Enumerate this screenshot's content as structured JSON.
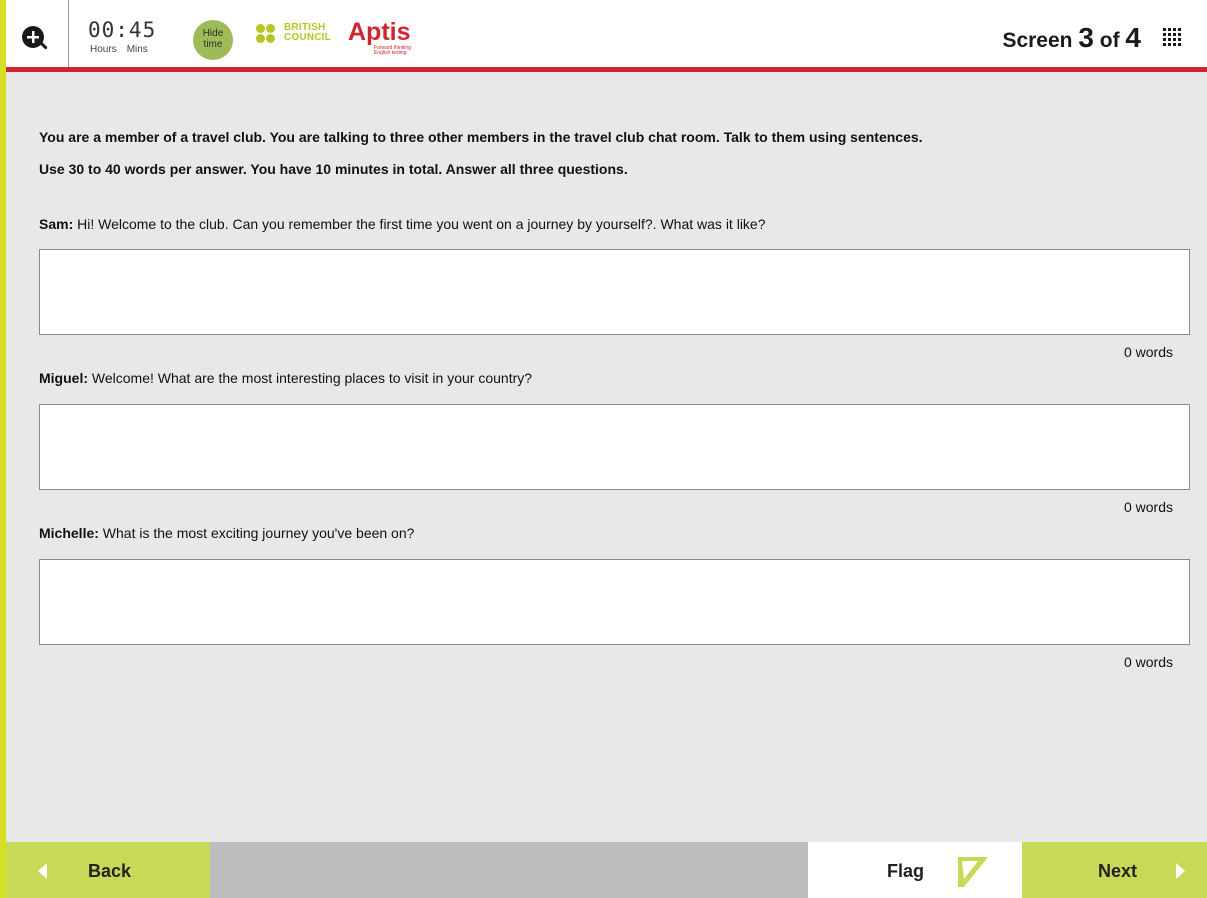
{
  "header": {
    "timer": {
      "value": "00:45",
      "hours_label": "Hours",
      "mins_label": "Mins"
    },
    "hide_time_label": "Hide time",
    "logo": {
      "org_line1": "BRITISH",
      "org_line2": "COUNCIL",
      "product": "Aptis",
      "tagline": "Forward thinking English testing"
    },
    "screen": {
      "prefix": "Screen",
      "current": "3",
      "of": "of",
      "total": "4"
    }
  },
  "instructions": [
    "You are a member of a travel club. You are talking to three other members in the travel club chat room. Talk to them using sentences.",
    "Use 30 to 40 words per answer. You have 10 minutes in total. Answer all three questions."
  ],
  "questions": [
    {
      "speaker": "Sam:",
      "text": " Hi! Welcome to the club. Can you remember the first time you went on a journey by yourself?. What was it like?",
      "answer": "",
      "word_count": "0 words"
    },
    {
      "speaker": "Miguel:",
      "text": "  Welcome! What are the most interesting places to visit in your country?",
      "answer": "",
      "word_count": "0 words"
    },
    {
      "speaker": "Michelle:",
      "text": " What is the most exciting journey you've been on?",
      "answer": "",
      "word_count": "0 words"
    }
  ],
  "footer": {
    "back_label": "Back",
    "flag_label": "Flag",
    "next_label": "Next"
  },
  "colors": {
    "accent_green": "#c8d957",
    "brand_red": "#d1262e",
    "border_yellow": "#d6df23"
  }
}
